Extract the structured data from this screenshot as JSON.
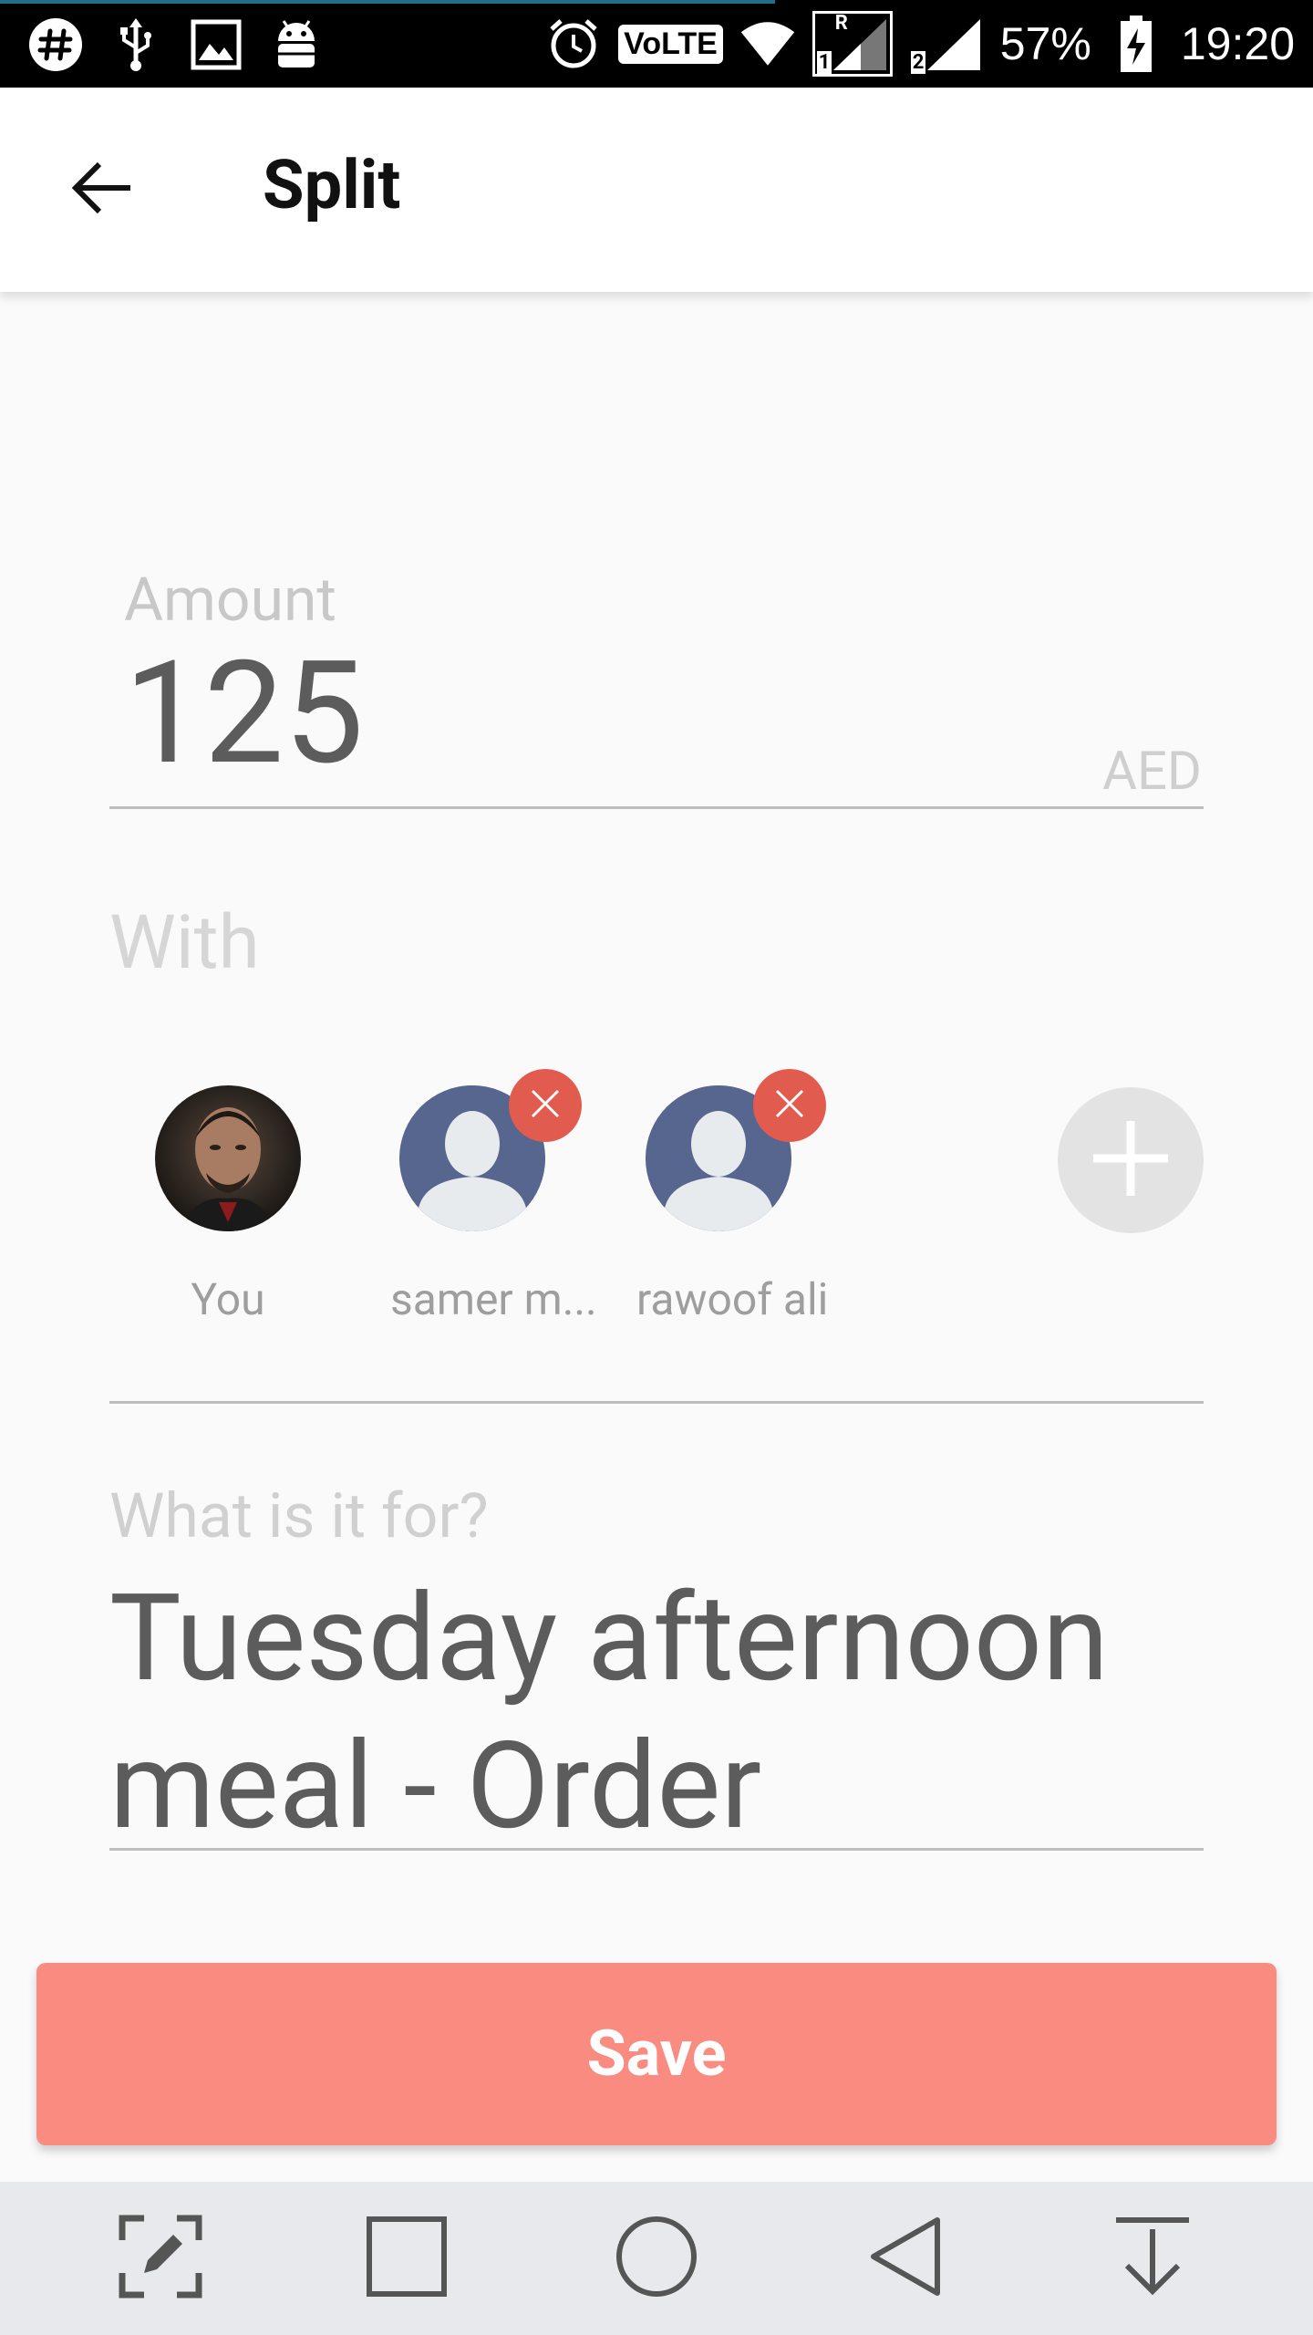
{
  "status_bar": {
    "battery": "57%",
    "time": "19:20",
    "network_badge": "VoLTE",
    "sim1_label": "1",
    "sim1_roaming": "R",
    "sim2_label": "2",
    "icons": [
      "slack-icon",
      "usb-icon",
      "image-icon",
      "android-icon",
      "alarm-icon",
      "volte-icon",
      "wifi-icon",
      "signal-sim1-icon",
      "signal-sim2-icon",
      "battery-charging-icon"
    ]
  },
  "app_bar": {
    "title": "Split",
    "back_icon": "arrow-back-icon"
  },
  "amount": {
    "label": "Amount",
    "value": "125",
    "currency": "AED"
  },
  "with": {
    "label": "With",
    "participants": [
      {
        "name": "You",
        "removable": false,
        "has_photo": true
      },
      {
        "name": "samer m...",
        "removable": true,
        "has_photo": false
      },
      {
        "name": "rawoof ali",
        "removable": true,
        "has_photo": false
      }
    ],
    "add_icon": "plus-icon"
  },
  "purpose": {
    "label": "What is it for?",
    "value": "Tuesday afternoon meal - Order"
  },
  "save_button": {
    "label": "Save"
  },
  "nav_bar": {
    "icons": [
      "edit-screenshot-icon",
      "recents-icon",
      "home-icon",
      "back-icon",
      "download-icon"
    ]
  },
  "colors": {
    "save_bg": "#f98b81",
    "remove_badge": "#e25b4f",
    "avatar_placeholder": "#57668f",
    "status_bar": "#000000",
    "nav_bar": "#e8e9ed"
  }
}
